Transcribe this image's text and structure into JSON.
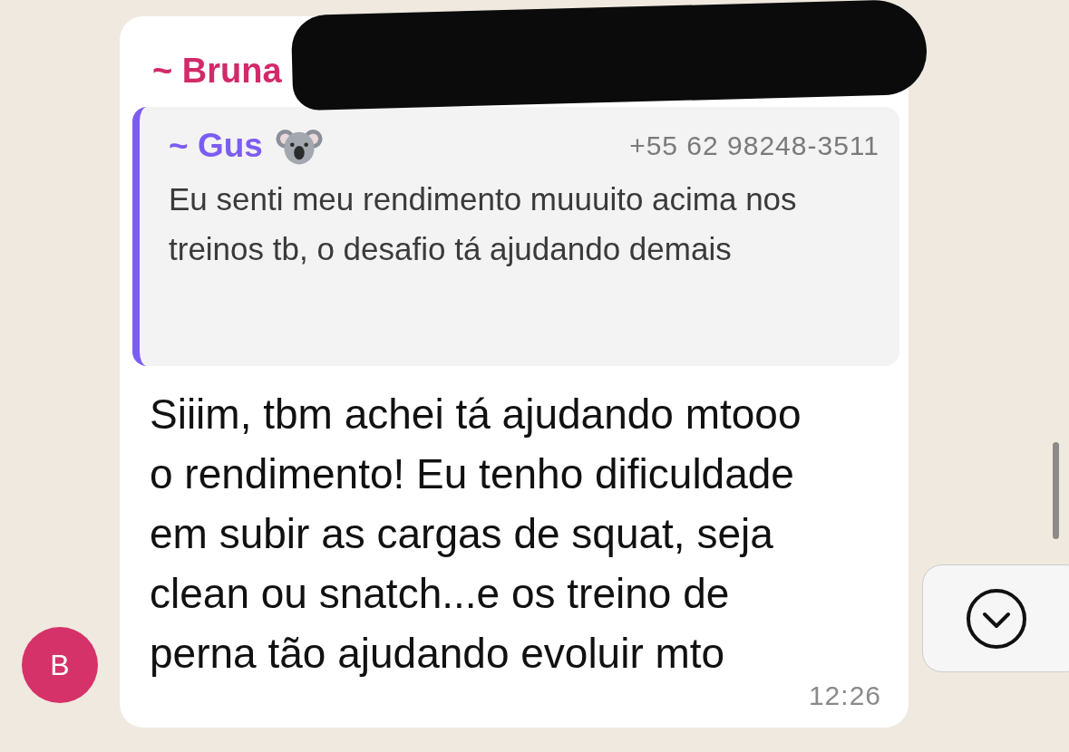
{
  "message": {
    "sender": "~ Bruna",
    "redacted": true,
    "avatar_letter": "B",
    "quote": {
      "author": "~ Gus",
      "phone": "+55 62 98248-3511",
      "text": "Eu senti meu rendimento muuuito acima nos treinos tb, o desafio tá ajudando demais"
    },
    "text": "Siiim, tbm achei tá ajudando mtooo o rendimento! Eu tenho dificuldade em subir as cargas de squat, seja clean ou snatch...e os treino de perna tão ajudando evoluir mto",
    "time": "12:26"
  }
}
